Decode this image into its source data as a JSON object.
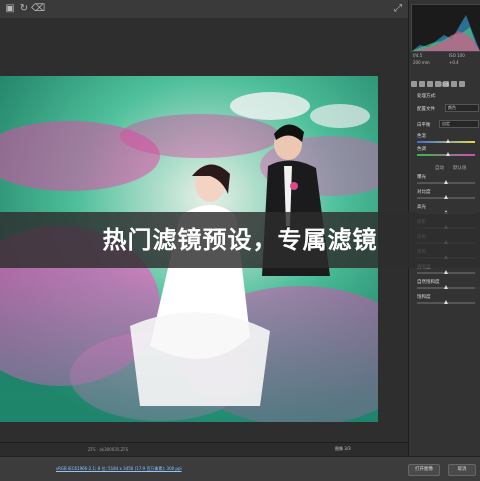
{
  "toolbar": {
    "icons": [
      "select-icon",
      "refresh-icon",
      "trash-icon",
      "expand-icon"
    ]
  },
  "camera": {
    "iso": "ISO 100",
    "aperture": "f/4.5",
    "lens": "200 mm",
    "ev": "+0.4"
  },
  "panel": {
    "section_title": "基本",
    "process_label": "处理方式:",
    "profile_label": "配置文件",
    "profile_value": "颜色",
    "wb_label": "白平衡",
    "wb_value": "自定",
    "temp_label": "色温",
    "tint_label": "色调",
    "auto_label": "自动",
    "default_label": "默认值",
    "sliders": [
      {
        "label": "曝光",
        "value": 0.5
      },
      {
        "label": "对比度",
        "value": 0.5
      },
      {
        "label": "高光",
        "value": 0.5
      },
      {
        "label": "阴影",
        "value": 0.5
      },
      {
        "label": "白色",
        "value": 0.5
      },
      {
        "label": "黑色",
        "value": 0.5
      },
      {
        "label": "清晰度",
        "value": 0.5
      },
      {
        "label": "自然饱和度",
        "value": 0.5
      },
      {
        "label": "饱和度",
        "value": 0.5
      }
    ]
  },
  "banner": {
    "text": "热门滤镜预设，专属滤镜"
  },
  "status": {
    "filename": "ZFS · ak300035.ZFS",
    "zoom": "图像 3/3"
  },
  "bottom": {
    "workflow_link": "sRGB IEC61966-2.1; 8 位; 5184 x 3456 (17.9 百万像素); 300 ppi",
    "open_button": "打开图像",
    "cancel_button": "取消"
  }
}
